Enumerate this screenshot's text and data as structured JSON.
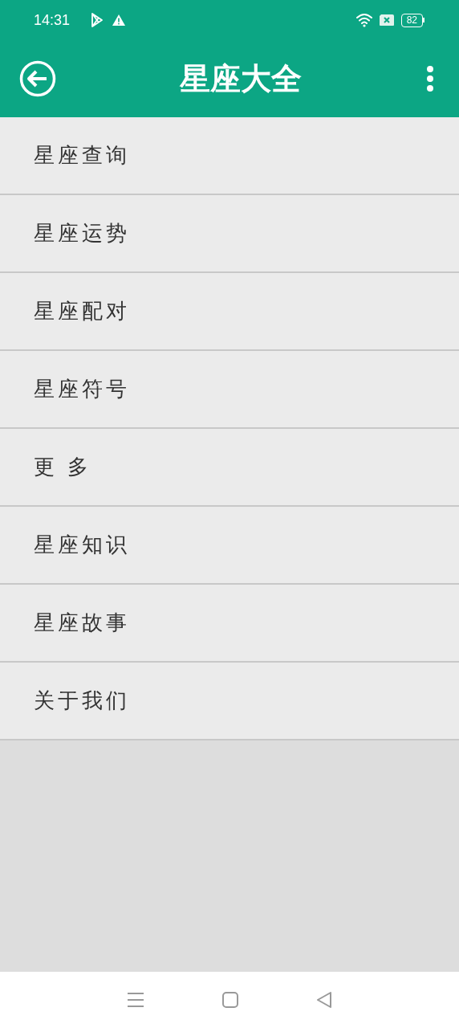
{
  "status_bar": {
    "time": "14:31",
    "battery": "82"
  },
  "app_bar": {
    "title": "星座大全"
  },
  "menu": [
    {
      "label": "星座查询"
    },
    {
      "label": "星座运势"
    },
    {
      "label": "星座配对"
    },
    {
      "label": "星座符号"
    },
    {
      "label": "更 多"
    },
    {
      "label": "星座知识"
    },
    {
      "label": "星座故事"
    },
    {
      "label": "关于我们"
    }
  ]
}
